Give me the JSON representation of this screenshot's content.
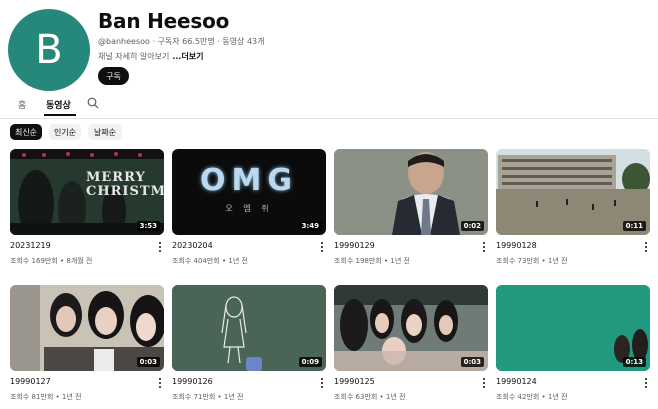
{
  "channel": {
    "avatar_letter": "B",
    "name": "Ban Heesoo",
    "meta": "@banheesoo · 구독자 66.5만명 · 동영상 43개",
    "description": "채널 자세히 알아보기",
    "more_label": "...더보기",
    "subscribe_label": "구독",
    "avatar_color": "#26877b"
  },
  "tabs": {
    "home": "홈",
    "videos": "동영상",
    "search_icon": "search-icon"
  },
  "chips": [
    "최신순",
    "인기순",
    "날짜순"
  ],
  "videos": [
    {
      "title": "20231219",
      "meta": "조회수 169만회 • 8개월 전",
      "duration": "3:53",
      "thumb_text": "MERRY CHRISTMAS"
    },
    {
      "title": "20230204",
      "meta": "조회수 404만회 • 1년 전",
      "duration": "3:49",
      "thumb_text": "OMG",
      "thumb_sub": "오 엠 쥐"
    },
    {
      "title": "19990129",
      "meta": "조회수 198만회 • 1년 전",
      "duration": "0:02"
    },
    {
      "title": "19990128",
      "meta": "조회수 73만회 • 1년 전",
      "duration": "0:11"
    },
    {
      "title": "19990127",
      "meta": "조회수 81만회 • 1년 전",
      "duration": "0:03"
    },
    {
      "title": "19990126",
      "meta": "조회수 71만회 • 1년 전",
      "duration": "0:09"
    },
    {
      "title": "19990125",
      "meta": "조회수 63만회 • 1년 전",
      "duration": "0:03"
    },
    {
      "title": "19990124",
      "meta": "조회수 42만회 • 1년 전",
      "duration": "0:13"
    }
  ]
}
